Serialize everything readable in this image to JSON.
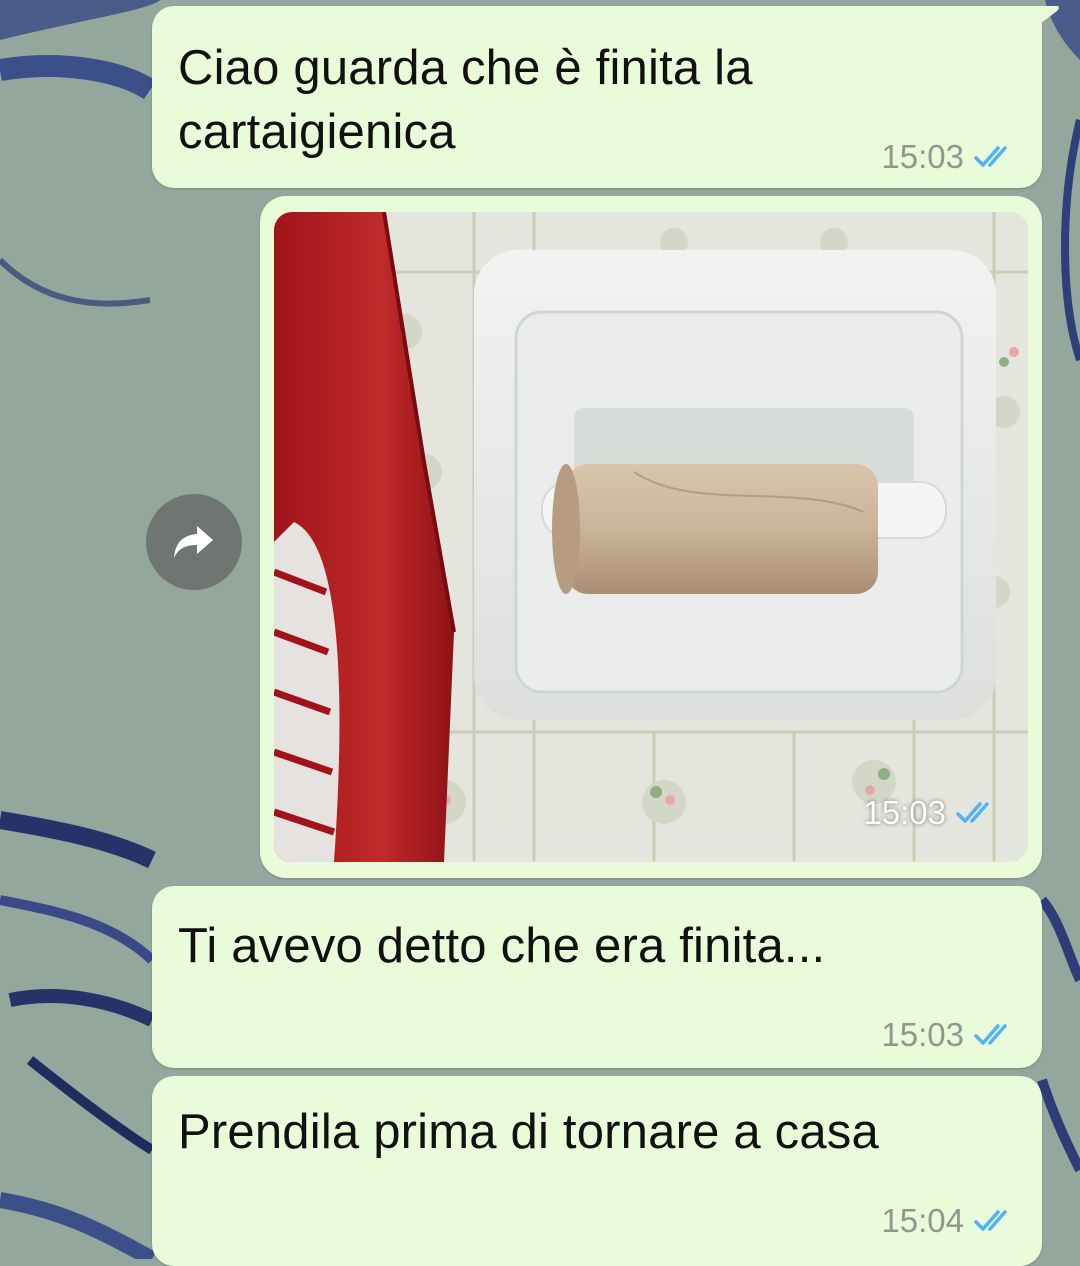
{
  "chat": {
    "messages": [
      {
        "text": "Ciao guarda che è finita la cartaigienica",
        "time": "15:03",
        "status": "read"
      },
      {
        "type": "image",
        "time": "15:03",
        "status": "read"
      },
      {
        "text": "Ti avevo detto che era finita...",
        "time": "15:03",
        "status": "read"
      },
      {
        "text": "Prendila prima di tornare a casa",
        "time": "15:04",
        "status": "read"
      }
    ],
    "forward_icon": "forward-arrow-icon",
    "read_icon": "double-check-icon"
  },
  "colors": {
    "outgoing_bubble": "#e9fbd9",
    "read_tick": "#4fb3f6",
    "meta_text": "#8a9a8c",
    "wallpaper": "#93a79c"
  }
}
